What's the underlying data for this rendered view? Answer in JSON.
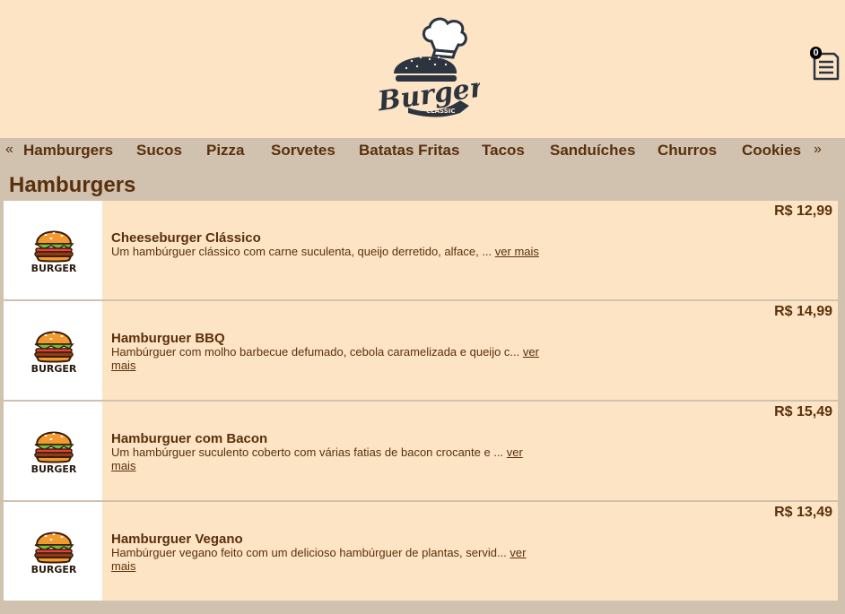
{
  "header": {
    "logo_text": "Burger",
    "logo_subtext": "CLASSIC",
    "cart_count": "0"
  },
  "nav": {
    "prev_arrow": "«",
    "next_arrow": "»",
    "items": [
      {
        "label": "Hamburgers"
      },
      {
        "label": "Sucos"
      },
      {
        "label": "Pizza"
      },
      {
        "label": "Sorvetes"
      },
      {
        "label": "Batatas Fritas"
      },
      {
        "label": "Tacos"
      },
      {
        "label": "Sanduíches"
      },
      {
        "label": "Churros"
      },
      {
        "label": "Cookies"
      }
    ]
  },
  "section": {
    "title": "Hamburgers"
  },
  "products": [
    {
      "name": "Cheeseburger Clássico",
      "description": "Um hambúrguer clássico com carne suculenta, queijo derretido, alface, ...",
      "more": "ver mais",
      "price": "R$ 12,99",
      "image_label": "BURGER"
    },
    {
      "name": "Hamburguer BBQ",
      "description": "Hambúrguer com molho barbecue defumado, cebola caramelizada e queijo c...",
      "more": "ver mais",
      "price": "R$ 14,99",
      "image_label": "BURGER"
    },
    {
      "name": "Hamburguer com Bacon",
      "description": "Um hambúrguer suculento coberto com várias fatias de bacon crocante e ...",
      "more": "ver mais",
      "price": "R$ 15,49",
      "image_label": "BURGER"
    },
    {
      "name": "Hamburguer Vegano",
      "description": "Hambúrguer vegano feito com um delicioso hambúrguer de plantas, servid...",
      "more": "ver mais",
      "price": "R$ 13,49",
      "image_label": "BURGER"
    }
  ],
  "colors": {
    "header_bg": "#fde4c4",
    "page_bg": "#d1c2af",
    "card_bg": "#fde4c4",
    "text": "#5a300c",
    "logo_dark": "#2b3440"
  },
  "icons": {
    "logo": "burger-chef-logo",
    "cart": "receipt-icon",
    "product_image": "burger-illustration"
  }
}
